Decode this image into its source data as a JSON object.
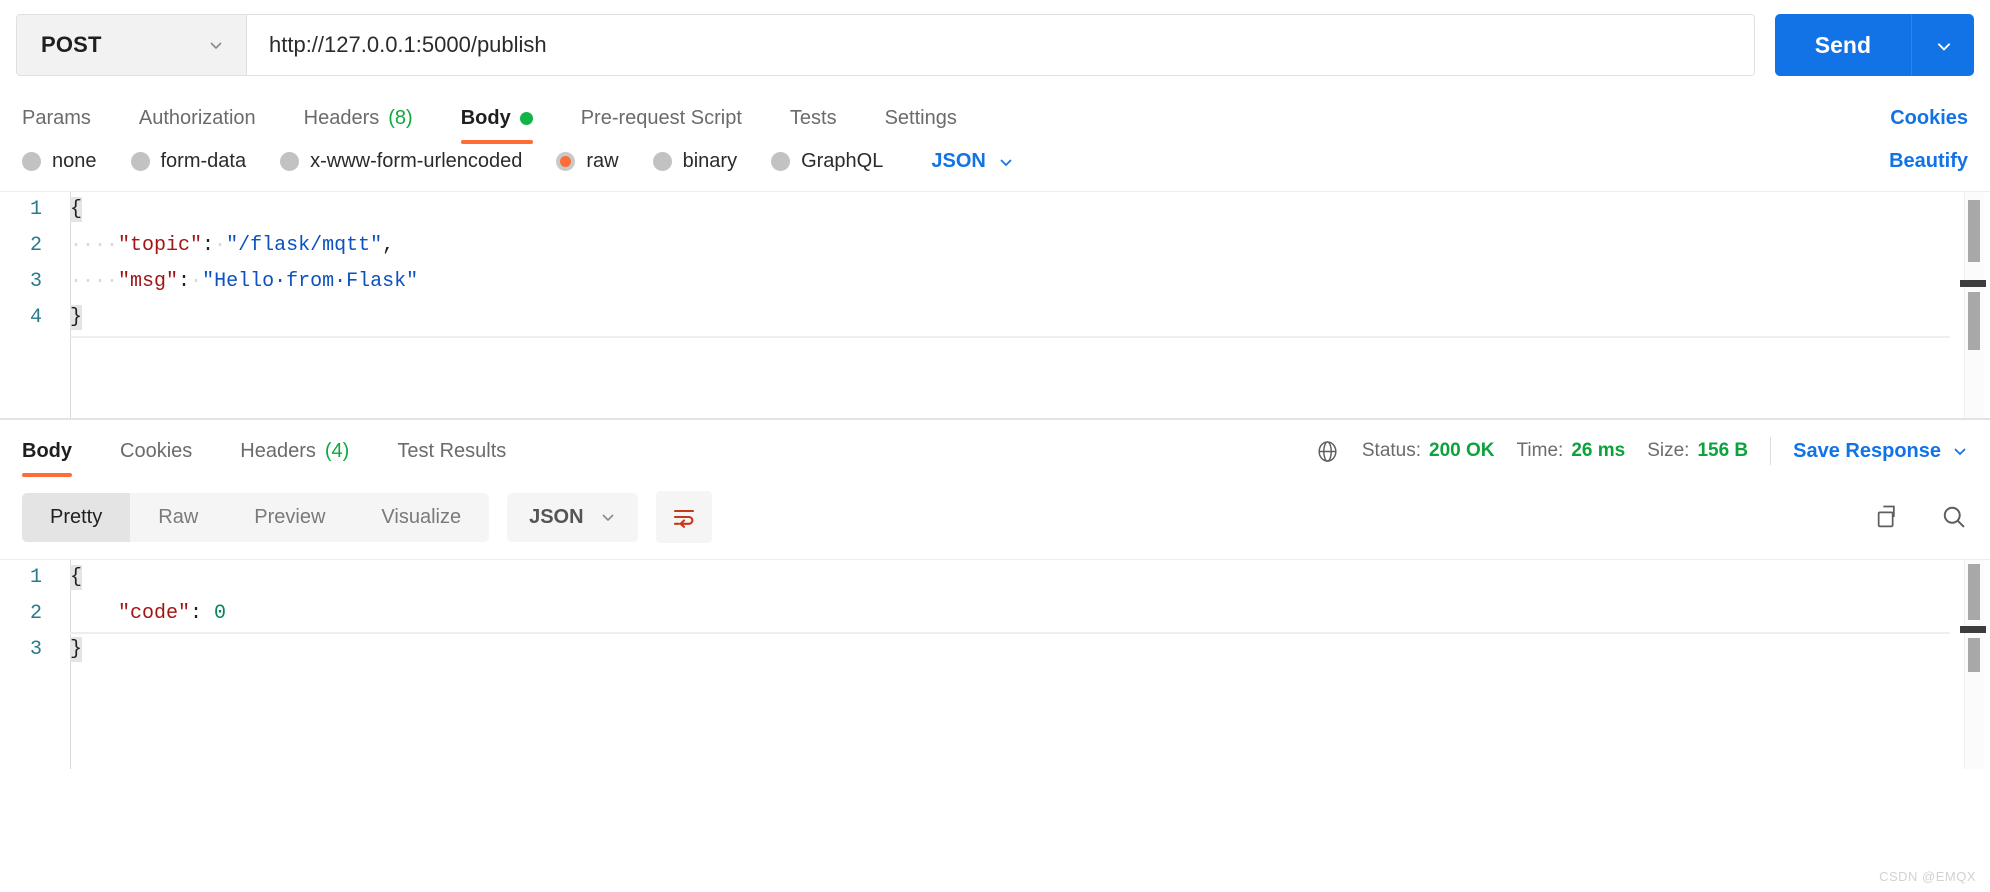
{
  "request": {
    "method": "POST",
    "url": "http://127.0.0.1:5000/publish",
    "send_label": "Send",
    "tabs": [
      {
        "label": "Params",
        "count": "",
        "active": false,
        "dot": false
      },
      {
        "label": "Authorization",
        "count": "",
        "active": false,
        "dot": false
      },
      {
        "label": "Headers",
        "count": "(8)",
        "active": false,
        "dot": false
      },
      {
        "label": "Body",
        "count": "",
        "active": true,
        "dot": true
      },
      {
        "label": "Pre-request Script",
        "count": "",
        "active": false,
        "dot": false
      },
      {
        "label": "Tests",
        "count": "",
        "active": false,
        "dot": false
      },
      {
        "label": "Settings",
        "count": "",
        "active": false,
        "dot": false
      }
    ],
    "cookies_link": "Cookies",
    "body_types": [
      {
        "label": "none",
        "selected": false
      },
      {
        "label": "form-data",
        "selected": false
      },
      {
        "label": "x-www-form-urlencoded",
        "selected": false
      },
      {
        "label": "raw",
        "selected": true
      },
      {
        "label": "binary",
        "selected": false
      },
      {
        "label": "GraphQL",
        "selected": false
      }
    ],
    "raw_format": "JSON",
    "beautify_label": "Beautify",
    "body_lines": [
      {
        "n": "1",
        "text": "{"
      },
      {
        "n": "2",
        "text": "    \"topic\": \"/flask/mqtt\","
      },
      {
        "n": "3",
        "text": "    \"msg\": \"Hello from Flask\""
      },
      {
        "n": "4",
        "text": "}"
      }
    ],
    "body_json": {
      "topic": "/flask/mqtt",
      "msg": "Hello from Flask"
    }
  },
  "response": {
    "tabs": [
      {
        "label": "Body",
        "count": "",
        "active": true
      },
      {
        "label": "Cookies",
        "count": "",
        "active": false
      },
      {
        "label": "Headers",
        "count": "(4)",
        "active": false
      },
      {
        "label": "Test Results",
        "count": "",
        "active": false
      }
    ],
    "meta": {
      "status_label": "Status:",
      "status_value": "200 OK",
      "time_label": "Time:",
      "time_value": "26 ms",
      "size_label": "Size:",
      "size_value": "156 B"
    },
    "save_response_label": "Save Response",
    "view_modes": [
      {
        "label": "Pretty",
        "active": true
      },
      {
        "label": "Raw",
        "active": false
      },
      {
        "label": "Preview",
        "active": false
      },
      {
        "label": "Visualize",
        "active": false
      }
    ],
    "format": "JSON",
    "body_lines": [
      {
        "n": "1",
        "text": "{"
      },
      {
        "n": "2",
        "text": "    \"code\": 0"
      },
      {
        "n": "3",
        "text": "}"
      }
    ],
    "body_json": {
      "code": 0
    }
  },
  "watermark": "CSDN @EMQX",
  "colors": {
    "accent_orange": "#ff6c37",
    "link_blue": "#1273e6",
    "send_blue": "#1273e6",
    "success_green": "#0ca33c",
    "json_key": "#a31515",
    "json_string": "#0b51c1",
    "json_number": "#098658"
  }
}
